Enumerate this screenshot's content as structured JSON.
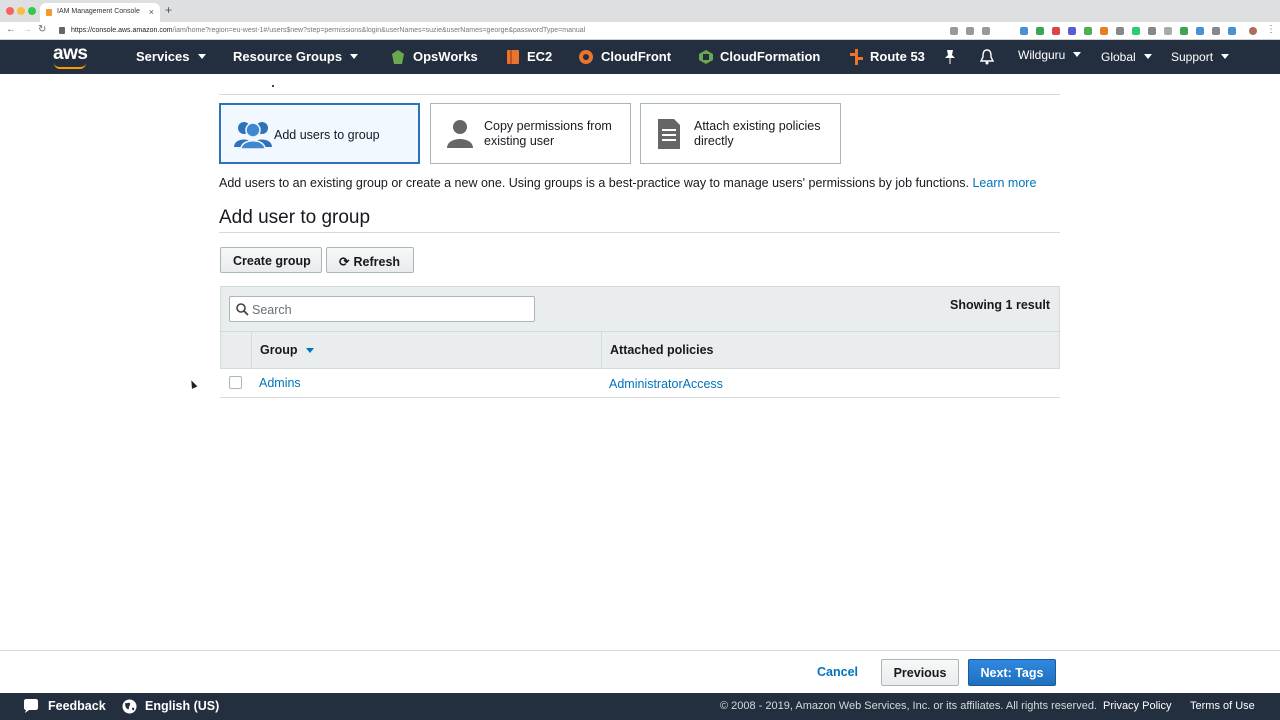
{
  "browser": {
    "tab_title": "IAM Management Console",
    "url_host": "https://console.aws.amazon.com",
    "url_path": "/iam/home?region=eu-west-1#/users$new?step=permissions&login&userNames=suzie&userNames=george&passwordType=manual"
  },
  "topnav": {
    "logo": "aws",
    "services": "Services",
    "resource_groups": "Resource Groups",
    "shortcuts": [
      "OpsWorks",
      "EC2",
      "CloudFront",
      "CloudFormation",
      "Route 53"
    ],
    "account": "Wildguru",
    "region": "Global",
    "support": "Support"
  },
  "options": [
    {
      "label": "Add users to group",
      "selected": true
    },
    {
      "label": "Copy permissions from existing user",
      "selected": false
    },
    {
      "label": "Attach existing policies directly",
      "selected": false
    }
  ],
  "description": "Add users to an existing group or create a new one. Using groups is a best-practice way to manage users' permissions by job functions.",
  "learn_more": "Learn more",
  "section_title": "Add user to group",
  "buttons": {
    "create_group": "Create group",
    "refresh": "Refresh"
  },
  "search": {
    "placeholder": "Search"
  },
  "showing": "Showing 1 result",
  "table": {
    "headers": [
      "Group",
      "Attached policies"
    ],
    "rows": [
      {
        "group": "Admins",
        "policies": "AdministratorAccess"
      }
    ]
  },
  "wizard": {
    "cancel": "Cancel",
    "previous": "Previous",
    "next": "Next: Tags"
  },
  "footer": {
    "feedback": "Feedback",
    "language": "English (US)",
    "copyright": "© 2008 - 2019, Amazon Web Services, Inc. or its affiliates. All rights reserved.",
    "privacy": "Privacy Policy",
    "terms": "Terms of Use"
  },
  "colors": {
    "aws_nav": "#232f3e",
    "accent": "#ff9900",
    "link": "#0073bb",
    "primary_button": "#1f6fbf"
  }
}
